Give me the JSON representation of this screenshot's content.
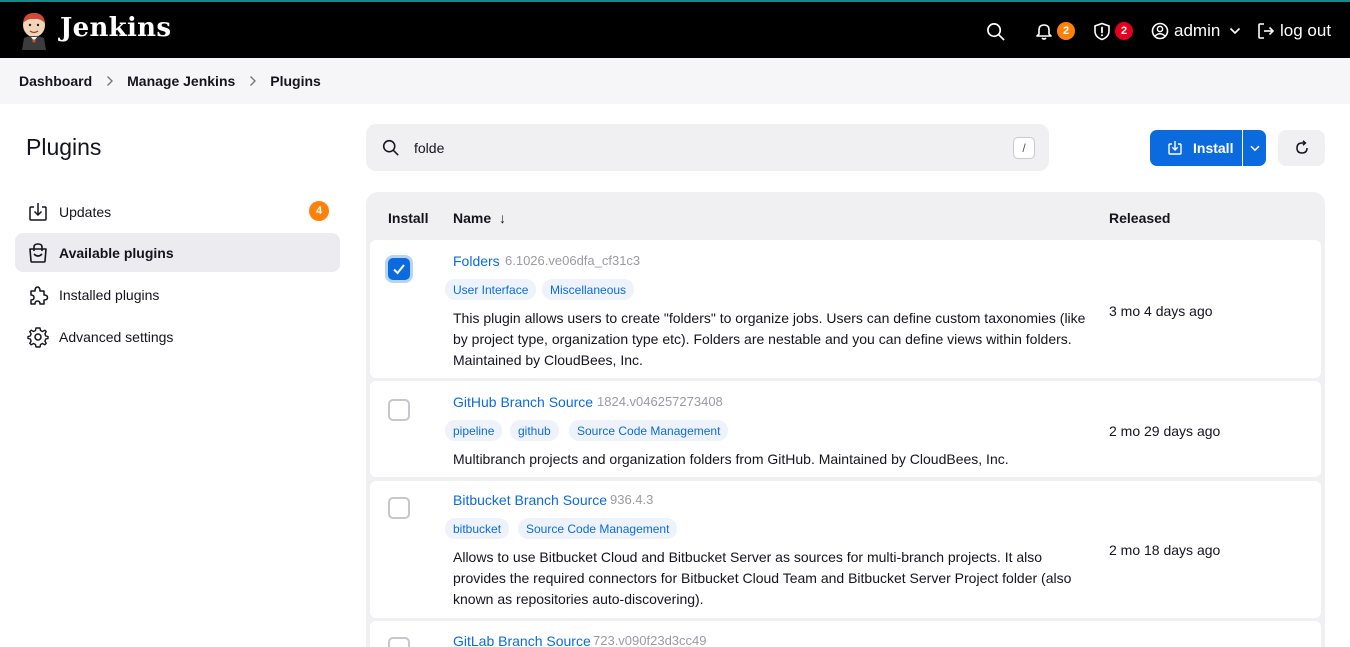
{
  "header": {
    "brand": "Jenkins",
    "notifications_count": "2",
    "security_count": "2",
    "user": "admin",
    "logout": "log out"
  },
  "breadcrumb": [
    "Dashboard",
    "Manage Jenkins",
    "Plugins"
  ],
  "sidebar": {
    "title": "Plugins",
    "items": [
      {
        "label": "Updates",
        "icon": "download-icon",
        "badge": "4",
        "active": false
      },
      {
        "label": "Available plugins",
        "icon": "shopping-bag-icon",
        "active": true
      },
      {
        "label": "Installed plugins",
        "icon": "puzzle-icon",
        "active": false
      },
      {
        "label": "Advanced settings",
        "icon": "gear-icon",
        "active": false
      }
    ]
  },
  "search": {
    "value": "folde",
    "shortcut": "/"
  },
  "toolbar": {
    "install_label": "Install"
  },
  "table": {
    "columns": [
      "Install",
      "Name",
      "Released"
    ],
    "name_sort_indicator": "↓",
    "rows": [
      {
        "checked": true,
        "name": "Folders",
        "version": "6.1026.ve06dfa_cf31c3",
        "tags": [
          "User Interface",
          "Miscellaneous"
        ],
        "description": "This plugin allows users to create \"folders\" to organize jobs. Users can define custom taxonomies (like by project type, organization type etc). Folders are nestable and you can define views within folders. Maintained by CloudBees, Inc.",
        "released": "3 mo 4 days ago"
      },
      {
        "checked": false,
        "name": "GitHub Branch Source",
        "version": "1824.v046257273408",
        "tags": [
          "pipeline",
          "github",
          "Source Code Management"
        ],
        "description": "Multibranch projects and organization folders from GitHub. Maintained by CloudBees, Inc.",
        "released": "2 mo 29 days ago"
      },
      {
        "checked": false,
        "name": "Bitbucket Branch Source",
        "version": "936.4.3",
        "tags": [
          "bitbucket",
          "Source Code Management"
        ],
        "description": "Allows to use Bitbucket Cloud and Bitbucket Server as sources for multi-branch projects. It also provides the required connectors for Bitbucket Cloud Team and Bitbucket Server Project folder (also known as repositories auto-discovering).",
        "released": "2 mo 18 days ago"
      },
      {
        "checked": false,
        "name": "GitLab Branch Source",
        "version": "723.v090f23d3cc49",
        "tags": [],
        "description": "",
        "released": ""
      }
    ]
  },
  "colors": {
    "accent": "#0b6bde",
    "header_bg": "#000000",
    "badge_orange": "#fe820a",
    "badge_red": "#e6001f"
  }
}
